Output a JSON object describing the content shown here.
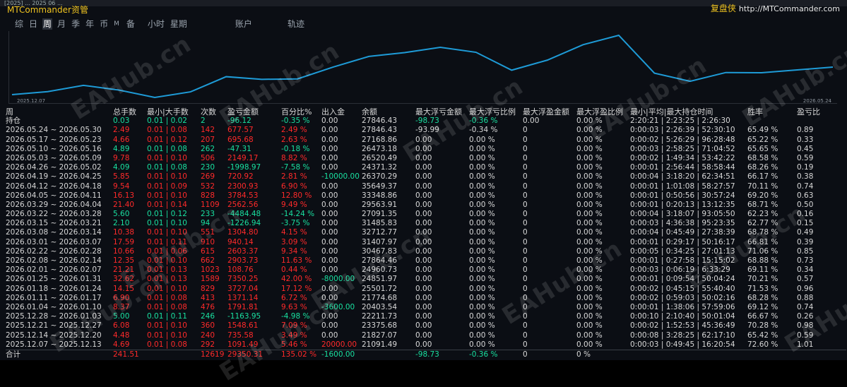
{
  "titlebar": {
    "text": "[2025] ... 2025 06 ..."
  },
  "brand": {
    "left": "MTCommander资管",
    "right_cn": "复盘侠",
    "right_url": "http://MTCommander.com"
  },
  "tabs": [
    {
      "label": "综",
      "active": false
    },
    {
      "label": "日",
      "active": false
    },
    {
      "label": "周",
      "active": true
    },
    {
      "label": "月",
      "active": false
    },
    {
      "label": "季",
      "active": false
    },
    {
      "label": "年",
      "active": false
    },
    {
      "label": "币",
      "active": false
    },
    {
      "label": "M",
      "active": false,
      "small": true
    },
    {
      "label": "备",
      "active": false
    },
    {
      "label": "小时",
      "active": false,
      "gap": true
    },
    {
      "label": "星期",
      "active": false
    },
    {
      "label": "账户",
      "active": false,
      "gap": true
    },
    {
      "label": "轨迹",
      "active": false,
      "gap": true
    }
  ],
  "chart": {
    "start_label": "2025.12.07",
    "end_label": "2026.05.24",
    "line_color": "#1e9bd7",
    "balance": [
      21091.49,
      21827.07,
      23375.68,
      22211.73,
      20403.54,
      21774.68,
      25501.72,
      24851.97,
      24960.73,
      27864.46,
      30467.83,
      31407.97,
      32712.77,
      31485.83,
      27091.35,
      29563.91,
      33348.86,
      35649.37,
      26370.29,
      24371.32,
      26520.49,
      26473.18,
      27168.86,
      27846.43
    ]
  },
  "watermark": "EAHub.cn",
  "columns": [
    "周",
    "总手数",
    "最小|大手数",
    "次数",
    "盈亏金额",
    "百分比%",
    "出入金",
    "余额",
    "最大浮亏金额",
    "最大浮亏比例",
    "最大浮盈金额",
    "最大浮盈比例",
    "最小|平均|最大持仓时间",
    "胜率",
    "盈亏比"
  ],
  "position_row": {
    "week": "持仓",
    "lots": "0.03",
    "minmax": "0.01 | 0.02",
    "count": "2",
    "pnl": "-96.12",
    "pct": "-0.35 %",
    "flow": "0.00",
    "balance": "27846.43",
    "max_float_loss": "-98.73",
    "max_float_loss_pct": "-0.36 %",
    "max_float_profit": "0.00",
    "max_float_profit_pct": "0.00 %",
    "hold_time": "2:20:21 | 2:23:25 | 2:26:30",
    "winrate": "",
    "pf": ""
  },
  "rows": [
    {
      "week": "2026.05.24 ~ 2026.05.30",
      "lots": "2.49",
      "minmax": "0.01 | 0.08",
      "count": "142",
      "pnl": "677.57",
      "pct": "2.49 %",
      "flow": "0.00",
      "balance": "27846.43",
      "mfl": "-93.99",
      "mflp": "-0.34 %",
      "mfp": "0",
      "mfpp": "0.00 %",
      "hold": "0:00:03 | 2:26:39 | 52:30:10",
      "win": "65.49 %",
      "pf": "0.89",
      "color": "red"
    },
    {
      "week": "2026.05.17 ~ 2026.05.23",
      "lots": "4.66",
      "minmax": "0.01 | 0.12",
      "count": "207",
      "pnl": "695.68",
      "pct": "2.63 %",
      "flow": "0.00",
      "balance": "27168.86",
      "mfl": "0.00",
      "mflp": "0.00 %",
      "mfp": "0",
      "mfpp": "0.00 %",
      "hold": "0:00:02 | 5:26:29 | 96:28:48",
      "win": "65.22 %",
      "pf": "0.33",
      "color": "red"
    },
    {
      "week": "2026.05.10 ~ 2026.05.16",
      "lots": "4.89",
      "minmax": "0.01 | 0.08",
      "count": "262",
      "pnl": "-47.31",
      "pct": "-0.18 %",
      "flow": "0.00",
      "balance": "26473.18",
      "mfl": "0.00",
      "mflp": "0.00 %",
      "mfp": "0",
      "mfpp": "0.00 %",
      "hold": "0:00:03 | 2:58:25 | 71:04:52",
      "win": "65.65 %",
      "pf": "0.45",
      "color": "grn"
    },
    {
      "week": "2026.05.03 ~ 2026.05.09",
      "lots": "9.78",
      "minmax": "0.01 | 0.10",
      "count": "506",
      "pnl": "2149.17",
      "pct": "8.82 %",
      "flow": "0.00",
      "balance": "26520.49",
      "mfl": "0.00",
      "mflp": "0.00 %",
      "mfp": "0",
      "mfpp": "0.00 %",
      "hold": "0:00:02 | 1:49:34 | 53:42:22",
      "win": "68.58 %",
      "pf": "0.59",
      "color": "red"
    },
    {
      "week": "2026.04.26 ~ 2026.05.02",
      "lots": "4.09",
      "minmax": "0.01 | 0.08",
      "count": "230",
      "pnl": "-1998.97",
      "pct": "-7.58 %",
      "flow": "0.00",
      "balance": "24371.32",
      "mfl": "0.00",
      "mflp": "0.00 %",
      "mfp": "0",
      "mfpp": "0.00 %",
      "hold": "0:00:01 | 2:56:44 | 58:58:44",
      "win": "68.26 %",
      "pf": "0.19",
      "color": "grn"
    },
    {
      "week": "2026.04.19 ~ 2026.04.25",
      "lots": "5.85",
      "minmax": "0.01 | 0.10",
      "count": "269",
      "pnl": "720.92",
      "pct": "2.81 %",
      "flow": "-10000.00",
      "balance": "26370.29",
      "mfl": "0.00",
      "mflp": "0.00 %",
      "mfp": "0",
      "mfpp": "0.00 %",
      "hold": "0:00:04 | 3:18:20 | 62:34:51",
      "win": "66.17 %",
      "pf": "0.38",
      "color": "red"
    },
    {
      "week": "2026.04.12 ~ 2026.04.18",
      "lots": "9.54",
      "minmax": "0.01 | 0.09",
      "count": "532",
      "pnl": "2300.93",
      "pct": "6.90 %",
      "flow": "0.00",
      "balance": "35649.37",
      "mfl": "0.00",
      "mflp": "0.00 %",
      "mfp": "0",
      "mfpp": "0.00 %",
      "hold": "0:00:01 | 1:01:08 | 58:27:57",
      "win": "70.11 %",
      "pf": "0.74",
      "color": "red"
    },
    {
      "week": "2026.04.05 ~ 2026.04.11",
      "lots": "16.13",
      "minmax": "0.01 | 0.10",
      "count": "828",
      "pnl": "3784.53",
      "pct": "12.80 %",
      "flow": "0.00",
      "balance": "33348.86",
      "mfl": "0.00",
      "mflp": "0.00 %",
      "mfp": "0",
      "mfpp": "0.00 %",
      "hold": "0:00:01 | 0:50:56 | 30:57:24",
      "win": "69.20 %",
      "pf": "0.63",
      "color": "red"
    },
    {
      "week": "2026.03.29 ~ 2026.04.04",
      "lots": "21.40",
      "minmax": "0.01 | 0.14",
      "count": "1109",
      "pnl": "2562.56",
      "pct": "9.49 %",
      "flow": "0.00",
      "balance": "29563.91",
      "mfl": "0.00",
      "mflp": "0.00 %",
      "mfp": "0",
      "mfpp": "0.00 %",
      "hold": "0:00:01 | 0:20:13 | 13:12:35",
      "win": "68.71 %",
      "pf": "0.50",
      "color": "red"
    },
    {
      "week": "2026.03.22 ~ 2026.03.28",
      "lots": "5.60",
      "minmax": "0.01 | 0.12",
      "count": "233",
      "pnl": "-4484.48",
      "pct": "-14.24 %",
      "flow": "0.00",
      "balance": "27091.35",
      "mfl": "0.00",
      "mflp": "0.00 %",
      "mfp": "0",
      "mfpp": "0.00 %",
      "hold": "0:00:04 | 3:18:07 | 93:05:50",
      "win": "62.23 %",
      "pf": "0.16",
      "color": "grn"
    },
    {
      "week": "2026.03.15 ~ 2026.03.21",
      "lots": "2.10",
      "minmax": "0.01 | 0.10",
      "count": "94",
      "pnl": "-1226.94",
      "pct": "-3.75 %",
      "flow": "0.00",
      "balance": "31485.83",
      "mfl": "0.00",
      "mflp": "0.00 %",
      "mfp": "0",
      "mfpp": "0.00 %",
      "hold": "0:00:03 | 4:36:38 | 95:23:35",
      "win": "62.77 %",
      "pf": "0.15",
      "color": "grn"
    },
    {
      "week": "2026.03.08 ~ 2026.03.14",
      "lots": "10.38",
      "minmax": "0.01 | 0.10",
      "count": "551",
      "pnl": "1304.80",
      "pct": "4.15 %",
      "flow": "0.00",
      "balance": "32712.77",
      "mfl": "0.00",
      "mflp": "0.00 %",
      "mfp": "0",
      "mfpp": "0.00 %",
      "hold": "0:00:04 | 0:45:49 | 27:38:39",
      "win": "68.78 %",
      "pf": "0.49",
      "color": "red"
    },
    {
      "week": "2026.03.01 ~ 2026.03.07",
      "lots": "17.59",
      "minmax": "0.01 | 0.11",
      "count": "910",
      "pnl": "940.14",
      "pct": "3.09 %",
      "flow": "0.00",
      "balance": "31407.97",
      "mfl": "0.00",
      "mflp": "0.00 %",
      "mfp": "0",
      "mfpp": "0.00 %",
      "hold": "0:00:01 | 0:29:17 | 50:16:17",
      "win": "66.81 %",
      "pf": "0.39",
      "color": "red"
    },
    {
      "week": "2026.02.22 ~ 2026.02.28",
      "lots": "10.66",
      "minmax": "0.01 | 0.06",
      "count": "615",
      "pnl": "2603.37",
      "pct": "9.34 %",
      "flow": "0.00",
      "balance": "30467.83",
      "mfl": "0.00",
      "mflp": "0.00 %",
      "mfp": "0",
      "mfpp": "0.00 %",
      "hold": "0:00:05 | 0:34:25 | 27:01:13",
      "win": "71.06 %",
      "pf": "0.85",
      "color": "red"
    },
    {
      "week": "2026.02.08 ~ 2026.02.14",
      "lots": "12.35",
      "minmax": "0.01 | 0.10",
      "count": "662",
      "pnl": "2903.73",
      "pct": "11.63 %",
      "flow": "0.00",
      "balance": "27864.46",
      "mfl": "0.00",
      "mflp": "0.00 %",
      "mfp": "0",
      "mfpp": "0.00 %",
      "hold": "0:00:01 | 0:27:58 | 15:15:02",
      "win": "68.88 %",
      "pf": "0.73",
      "color": "red"
    },
    {
      "week": "2026.02.01 ~ 2026.02.07",
      "lots": "21.21",
      "minmax": "0.01 | 0.13",
      "count": "1023",
      "pnl": "108.76",
      "pct": "0.44 %",
      "flow": "0.00",
      "balance": "24960.73",
      "mfl": "0.00",
      "mflp": "0.00 %",
      "mfp": "0",
      "mfpp": "0.00 %",
      "hold": "0:00:03 | 0:06:19 | 6:33:29",
      "win": "69.11 %",
      "pf": "0.34",
      "color": "red"
    },
    {
      "week": "2026.01.25 ~ 2026.01.31",
      "lots": "32.62",
      "minmax": "0.01 | 0.13",
      "count": "1589",
      "pnl": "7350.25",
      "pct": "42.00 %",
      "flow": "-8000.00",
      "balance": "24851.97",
      "mfl": "0.00",
      "mflp": "0.00 %",
      "mfp": "0",
      "mfpp": "0.00 %",
      "hold": "0:00:01 | 0:09:54 | 50:04:24",
      "win": "70.21 %",
      "pf": "0.57",
      "color": "red"
    },
    {
      "week": "2026.01.18 ~ 2026.01.24",
      "lots": "14.15",
      "minmax": "0.01 | 0.10",
      "count": "829",
      "pnl": "3727.04",
      "pct": "17.12 %",
      "flow": "0.00",
      "balance": "25501.72",
      "mfl": "0.00",
      "mflp": "0.00 %",
      "mfp": "0",
      "mfpp": "0.00 %",
      "hold": "0:00:02 | 0:45:15 | 55:40:40",
      "win": "71.53 %",
      "pf": "0.96",
      "color": "red"
    },
    {
      "week": "2026.01.11 ~ 2026.01.17",
      "lots": "6.90",
      "minmax": "0.01 | 0.08",
      "count": "413",
      "pnl": "1371.14",
      "pct": "6.72 %",
      "flow": "0.00",
      "balance": "21774.68",
      "mfl": "0.00",
      "mflp": "0.00 %",
      "mfp": "0",
      "mfpp": "0.00 %",
      "hold": "0:00:02 | 0:59:03 | 50:02:16",
      "win": "68.28 %",
      "pf": "0.88",
      "color": "red"
    },
    {
      "week": "2026.01.04 ~ 2026.01.10",
      "lots": "8.37",
      "minmax": "0.01 | 0.08",
      "count": "476",
      "pnl": "1791.81",
      "pct": "9.63 %",
      "flow": "-3600.00",
      "balance": "20403.54",
      "mfl": "0.00",
      "mflp": "0.00 %",
      "mfp": "0",
      "mfpp": "0.00 %",
      "hold": "0:00:01 | 1:38:06 | 57:59:06",
      "win": "69.12 %",
      "pf": "0.74",
      "color": "red"
    },
    {
      "week": "2025.12.28 ~ 2026.01.03",
      "lots": "5.00",
      "minmax": "0.01 | 0.11",
      "count": "246",
      "pnl": "-1163.95",
      "pct": "-4.98 %",
      "flow": "0.00",
      "balance": "22211.73",
      "mfl": "0.00",
      "mflp": "0.00 %",
      "mfp": "0",
      "mfpp": "0.00 %",
      "hold": "0:00:10 | 2:10:40 | 50:01:04",
      "win": "66.67 %",
      "pf": "0.26",
      "color": "grn"
    },
    {
      "week": "2025.12.21 ~ 2025.12.27",
      "lots": "6.08",
      "minmax": "0.01 | 0.10",
      "count": "360",
      "pnl": "1548.61",
      "pct": "7.09 %",
      "flow": "0.00",
      "balance": "23375.68",
      "mfl": "0.00",
      "mflp": "0.00 %",
      "mfp": "0",
      "mfpp": "0.00 %",
      "hold": "0:00:02 | 1:52:53 | 45:36:49",
      "win": "70.28 %",
      "pf": "0.98",
      "color": "red"
    },
    {
      "week": "2025.12.14 ~ 2025.12.20",
      "lots": "4.48",
      "minmax": "0.01 | 0.10",
      "count": "240",
      "pnl": "735.58",
      "pct": "3.49 %",
      "flow": "0.00",
      "balance": "21827.07",
      "mfl": "0.00",
      "mflp": "0.00 %",
      "mfp": "0",
      "mfpp": "0.00 %",
      "hold": "0:00:08 | 3:28:25 | 62:17:10",
      "win": "65.42 %",
      "pf": "0.59",
      "color": "red"
    },
    {
      "week": "2025.12.07 ~ 2025.12.13",
      "lots": "4.69",
      "minmax": "0.01 | 0.08",
      "count": "292",
      "pnl": "1091.49",
      "pct": "5.46 %",
      "flow": "20000.00",
      "balance": "21091.49",
      "mfl": "0.00",
      "mflp": "0.00 %",
      "mfp": "0",
      "mfpp": "0.00 %",
      "hold": "0:00:03 | 0:49:45 | 16:20:54",
      "win": "72.60 %",
      "pf": "1.01",
      "color": "red"
    }
  ],
  "total_row": {
    "week": "合计",
    "lots": "241.51",
    "count": "12619",
    "pnl": "29350.31",
    "pct": "135.02 %",
    "flow": "-1600.00",
    "mfl": "-98.73",
    "mflp": "-0.36 %",
    "mfp": "0",
    "mfpp": "0 %"
  }
}
